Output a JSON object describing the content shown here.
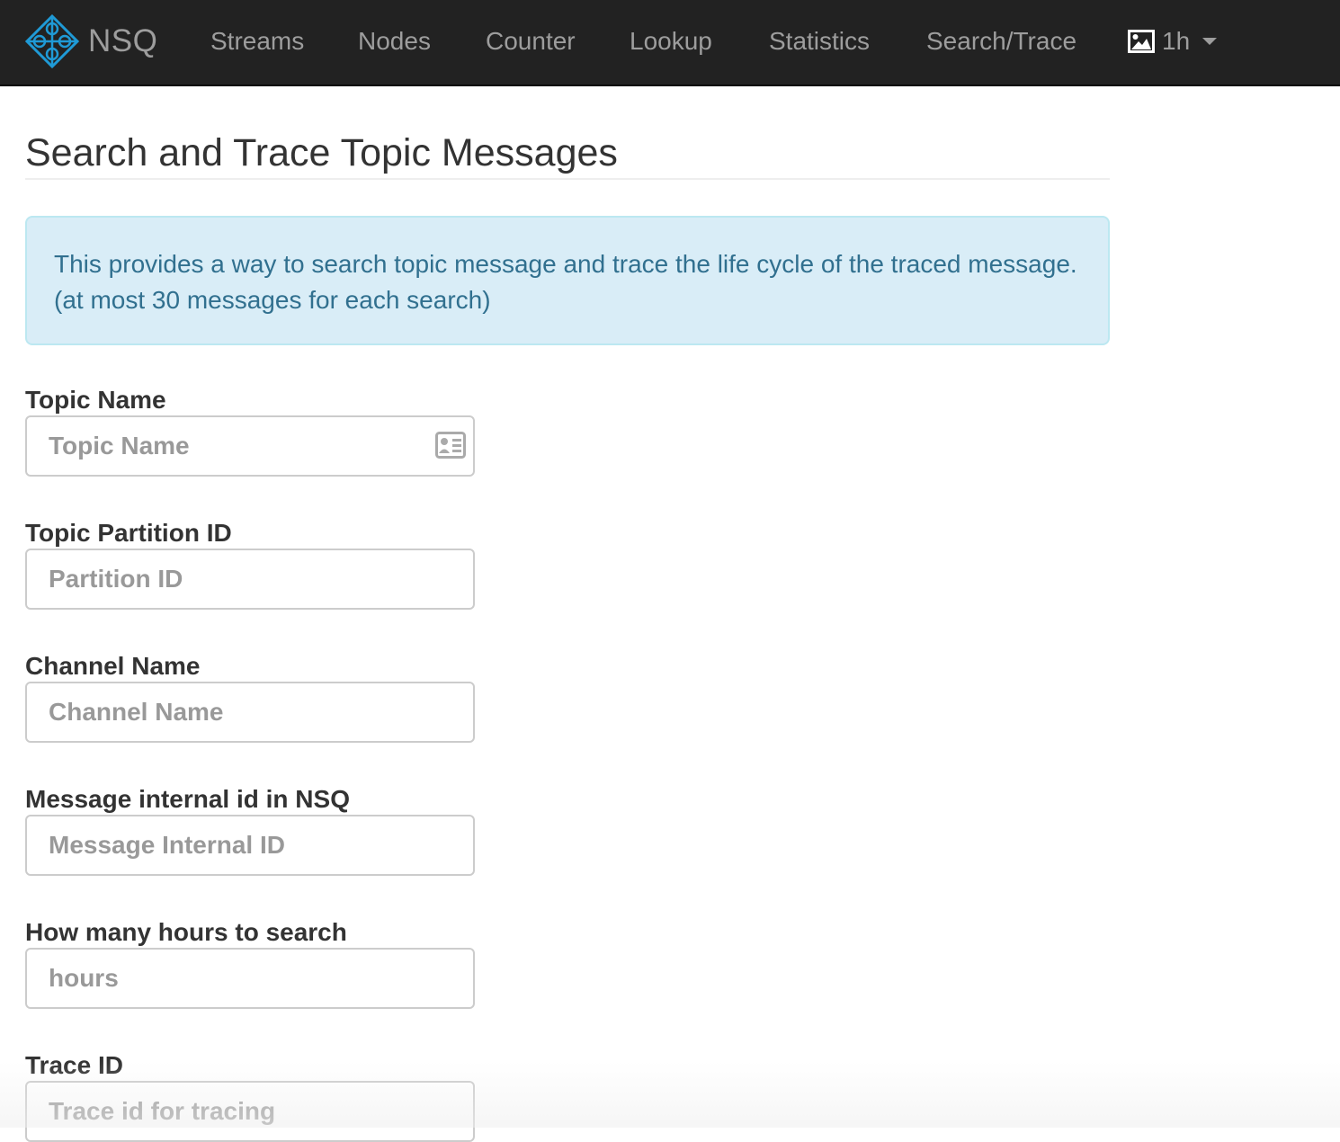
{
  "navbar": {
    "brand": "NSQ",
    "items": [
      {
        "label": "Streams"
      },
      {
        "label": "Nodes"
      },
      {
        "label": "Counter"
      },
      {
        "label": "Lookup"
      },
      {
        "label": "Statistics"
      },
      {
        "label": "Search/Trace"
      }
    ],
    "graph_interval": "1h",
    "graph_icon": "picture-icon"
  },
  "page": {
    "title": "Search and Trace Topic Messages",
    "info": "This provides a way to search topic message and trace the life cycle of the traced message. (at most 30 messages for each search)"
  },
  "form": {
    "fields": [
      {
        "label": "Topic Name",
        "placeholder": "Topic Name",
        "value": "",
        "icon": "contact-card-icon"
      },
      {
        "label": "Topic Partition ID",
        "placeholder": "Partition ID",
        "value": ""
      },
      {
        "label": "Channel Name",
        "placeholder": "Channel Name",
        "value": ""
      },
      {
        "label": "Message internal id in NSQ",
        "placeholder": "Message Internal ID",
        "value": ""
      },
      {
        "label": "How many hours to search",
        "placeholder": "hours",
        "value": ""
      },
      {
        "label": "Trace ID",
        "placeholder": "Trace id for tracing",
        "value": ""
      }
    ]
  },
  "colors": {
    "navbar_bg": "#222222",
    "nav_text": "#9d9d9d",
    "logo_accent": "#1f9ad6",
    "alert_bg": "#d9edf7",
    "alert_text": "#31708f"
  }
}
